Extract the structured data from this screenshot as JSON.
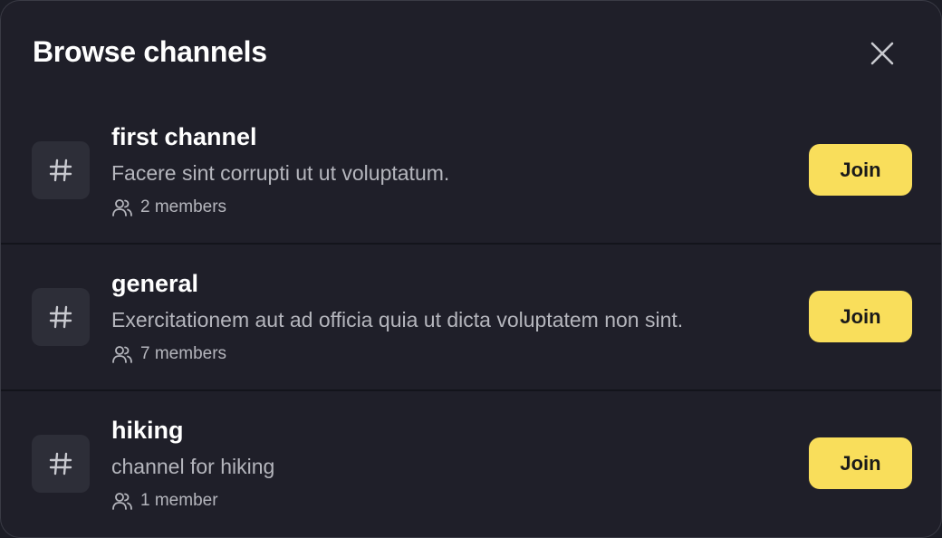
{
  "modal": {
    "title": "Browse channels",
    "close_icon": "close-icon"
  },
  "channels": [
    {
      "name": "first channel",
      "description": "Facere sint corrupti ut ut voluptatum.",
      "members": "2 members",
      "join_label": "Join"
    },
    {
      "name": "general",
      "description": "Exercitationem aut ad officia quia ut dicta voluptatem non sint.",
      "members": "7 members",
      "join_label": "Join"
    },
    {
      "name": "hiking",
      "description": "channel for hiking",
      "members": "1 member",
      "join_label": "Join"
    }
  ],
  "colors": {
    "background": "#1f1f29",
    "accent": "#f9de5b",
    "icon_tile": "#2d2e38",
    "muted_text": "#b5b6bd"
  },
  "icons": {
    "channel": "hash-icon",
    "members": "users-icon"
  }
}
